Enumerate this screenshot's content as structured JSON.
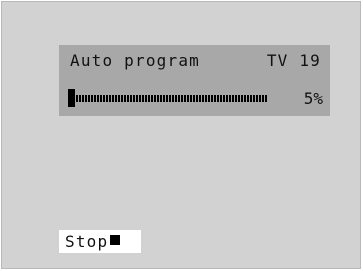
{
  "osd": {
    "title": "Auto program",
    "channel": "TV 19",
    "progress_percent_label": "5%",
    "progress_value": 0.05
  },
  "controls": {
    "stop_label": "Stop",
    "stop_icon": "stop-square-icon"
  },
  "colors": {
    "screen_background": "#d2d2d2",
    "osd_panel": "#a8a8a8",
    "text": "#111111",
    "button_background": "#ffffff"
  }
}
